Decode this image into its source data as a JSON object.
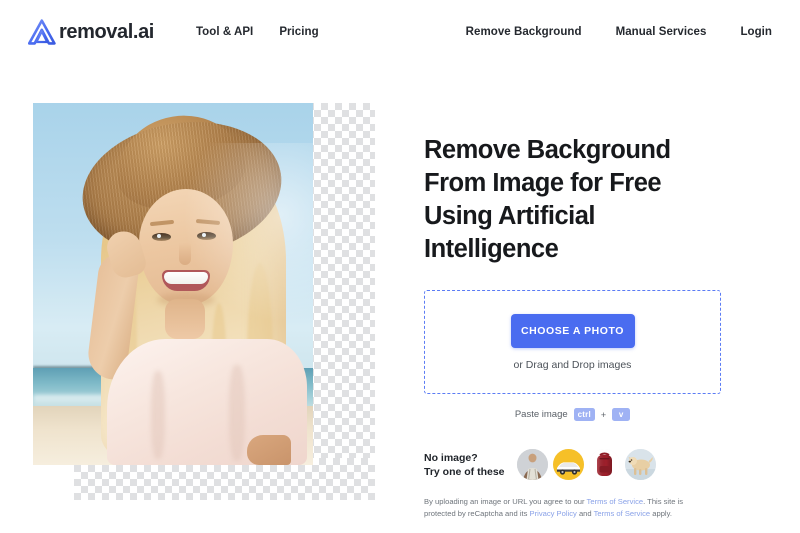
{
  "header": {
    "brand_name": "removal.ai",
    "logo_icon": "removal-ai-logo-icon",
    "nav_left": [
      {
        "label": "Tool & API"
      },
      {
        "label": "Pricing"
      }
    ],
    "nav_right": [
      {
        "label": "Remove Background"
      },
      {
        "label": "Manual Services"
      },
      {
        "label": "Login"
      }
    ]
  },
  "hero": {
    "photo_alt": "Smiling blonde woman in straw hat at the beach with background partially removed",
    "checkerboard_meaning": "transparent-background-preview"
  },
  "main": {
    "headline": "Remove Background From Image for Free Using Artificial Intelligence",
    "dropzone": {
      "button_label": "CHOOSE A PHOTO",
      "drag_hint": "or Drag and Drop images"
    },
    "paste": {
      "label": "Paste image",
      "key_modifier": "ctrl",
      "key_separator": "+",
      "key_action": "v"
    },
    "samples": {
      "label_line1": "No image?",
      "label_line2": "Try one of these",
      "items": [
        {
          "name": "sample-person",
          "alt": "Man in patterned shirt"
        },
        {
          "name": "sample-car",
          "alt": "Yellow sports car"
        },
        {
          "name": "sample-backpack",
          "alt": "Red backpack"
        },
        {
          "name": "sample-dog",
          "alt": "Golden retriever dog"
        }
      ]
    },
    "legal": {
      "part1": "By uploading an image or URL you agree to our",
      "link1": "Terms of Service",
      "part2": ". This site is protected by reCaptcha and its",
      "link2": "Privacy Policy",
      "part3": "and",
      "link3": "Terms of Service",
      "part4": "apply."
    }
  },
  "colors": {
    "accent": "#4a6cf0",
    "dropzone_border": "#5b7cf5",
    "kbd_badge": "#9fb2f4",
    "link": "#8aa2e8",
    "text_dark": "#17191c"
  }
}
